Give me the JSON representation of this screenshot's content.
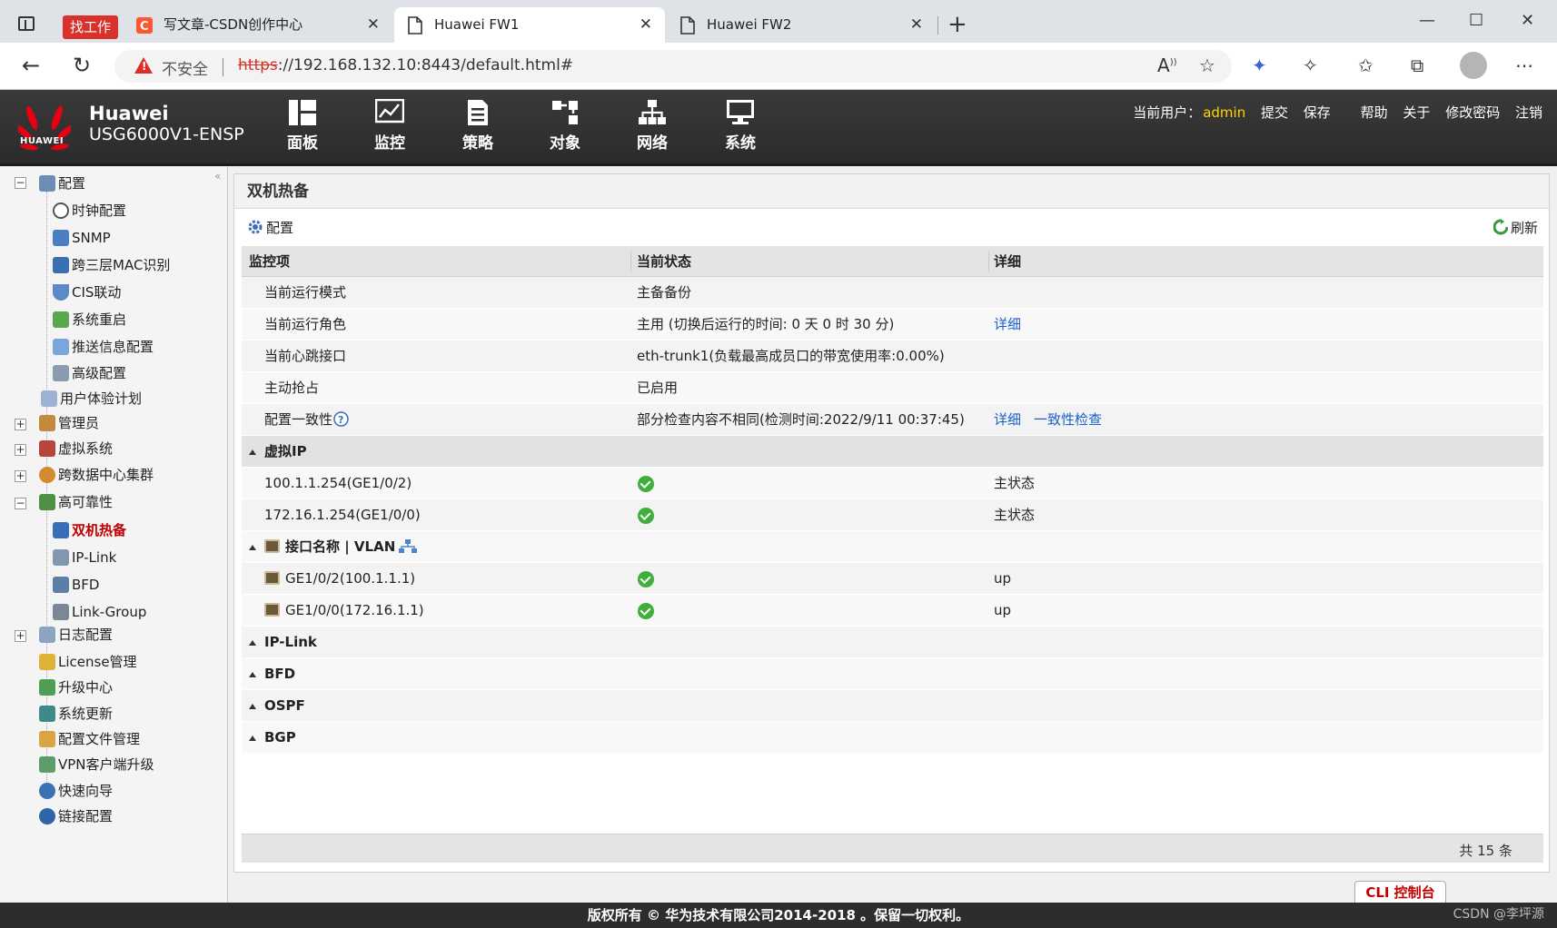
{
  "browser": {
    "work_badge": "找工作",
    "tabs": [
      {
        "title": "写文章-CSDN创作中心"
      },
      {
        "title": "Huawei FW1"
      },
      {
        "title": "Huawei FW2"
      }
    ],
    "insecure_label": "不安全",
    "url_scheme": "https",
    "url_rest": "://192.168.132.10:8443/default.html#"
  },
  "header": {
    "logo_text": "HUAWEI",
    "brand": "Huawei",
    "model": "USG6000V1-ENSP",
    "nav": [
      "面板",
      "监控",
      "策略",
      "对象",
      "网络",
      "系统"
    ],
    "user_label": "当前用户：",
    "user_name": "admin",
    "actions": [
      "提交",
      "保存",
      "帮助",
      "关于",
      "修改密码",
      "注销"
    ]
  },
  "sidebar": {
    "items": [
      {
        "label": "配置",
        "expander": "−"
      },
      {
        "label": "时钟配置"
      },
      {
        "label": "SNMP"
      },
      {
        "label": "跨三层MAC识别"
      },
      {
        "label": "CIS联动"
      },
      {
        "label": "系统重启"
      },
      {
        "label": "推送信息配置"
      },
      {
        "label": "高级配置"
      },
      {
        "label": "用户体验计划"
      },
      {
        "label": "管理员",
        "expander": "+"
      },
      {
        "label": "虚拟系统",
        "expander": "+"
      },
      {
        "label": "跨数据中心集群",
        "expander": "+"
      },
      {
        "label": "高可靠性",
        "expander": "−"
      },
      {
        "label": "双机热备"
      },
      {
        "label": "IP-Link"
      },
      {
        "label": "BFD"
      },
      {
        "label": "Link-Group"
      },
      {
        "label": "日志配置",
        "expander": "+"
      },
      {
        "label": "License管理"
      },
      {
        "label": "升级中心"
      },
      {
        "label": "系统更新"
      },
      {
        "label": "配置文件管理"
      },
      {
        "label": "VPN客户端升级"
      },
      {
        "label": "快速向导"
      },
      {
        "label": "链接配置"
      }
    ]
  },
  "panel": {
    "title": "双机热备",
    "config_label": "配置",
    "refresh_label": "刷新",
    "columns": [
      "监控项",
      "当前状态",
      "详细"
    ],
    "rows": [
      {
        "item": "当前运行模式",
        "status": "主备备份",
        "detail": ""
      },
      {
        "item": "当前运行角色",
        "status": "主用 (切换后运行的时间: 0 天 0 时 30 分)",
        "detail": "详细"
      },
      {
        "item": "当前心跳接口",
        "status": "eth-trunk1(负载最高成员口的带宽使用率:0.00%)",
        "detail": ""
      },
      {
        "item": "主动抢占",
        "status": "已启用",
        "detail": ""
      },
      {
        "item": "配置一致性",
        "status": "部分检查内容不相同(检测时间:2022/9/11 00:37:45)",
        "detail": "详细",
        "detail2": "一致性检查"
      }
    ],
    "group_vip": "虚拟IP",
    "vip_rows": [
      {
        "item": "100.1.1.254(GE1/0/2)",
        "detail": "主状态"
      },
      {
        "item": "172.16.1.254(GE1/0/0)",
        "detail": "主状态"
      }
    ],
    "group_iface": "接口名称 | VLAN",
    "iface_rows": [
      {
        "item": "GE1/0/2(100.1.1.1)",
        "detail": "up"
      },
      {
        "item": "GE1/0/0(172.16.1.1)",
        "detail": "up"
      }
    ],
    "other_groups": [
      "IP-Link",
      "BFD",
      "OSPF",
      "BGP"
    ],
    "total": "共 15 条"
  },
  "cli_label": "CLI 控制台",
  "copyright": "版权所有 © 华为技术有限公司2014-2018 。保留一切权利。",
  "watermark": "CSDN @李坪源",
  "colors": {
    "accent_red": "#c00000",
    "link_blue": "#1a5fcc",
    "header_dark": "#2b2b2b",
    "user_yellow": "#ffd400"
  }
}
